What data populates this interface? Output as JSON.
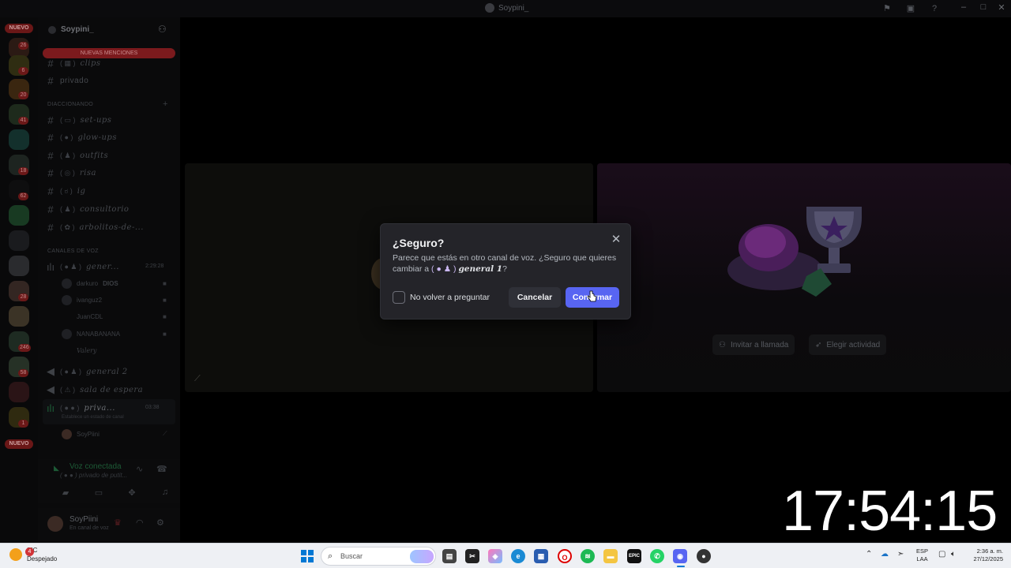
{
  "window": {
    "title": "Soypini_"
  },
  "rail": {
    "nuevo_top": "NUEVO",
    "nuevo_bottom": "NUEVO",
    "badges": [
      "26",
      "6",
      "20",
      "41",
      "18",
      "62",
      "28",
      "246",
      "58",
      "1"
    ]
  },
  "server": {
    "name": "Soypini_",
    "new_mentions": "NUEVAS MENCIONES"
  },
  "channels_top": [
    {
      "label": "clips",
      "emoji": "( ▦ )"
    },
    {
      "label": "privado",
      "emoji": ""
    }
  ],
  "category_1": "DIACCIONANDO",
  "text_channels": [
    {
      "emoji": "( ▭ )",
      "label": "set-ups"
    },
    {
      "emoji": "( ● )",
      "label": "glow-ups"
    },
    {
      "emoji": "( ♟ )",
      "label": "outfits"
    },
    {
      "emoji": "( ◎ )",
      "label": "risa"
    },
    {
      "emoji": "( ಠ )",
      "label": "ig"
    },
    {
      "emoji": "( ♟ )",
      "label": "consultorio"
    },
    {
      "emoji": "( ✿ )",
      "label": "arbolitos-de-..."
    }
  ],
  "category_2": "CANALES DE VOZ",
  "voice_channel_1": {
    "emoji": "( ● ♟ )",
    "label": "gener...",
    "time": "2:29:28"
  },
  "voice_users": [
    {
      "name": "darkuro",
      "tag": "DIOS"
    },
    {
      "name": "ivanguz2",
      "tag": ""
    },
    {
      "name": "JuanCDL",
      "tag": ""
    },
    {
      "name": "NANABANANA",
      "tag": ""
    },
    {
      "name": "Valery",
      "tag": ""
    }
  ],
  "voice_channel_2": {
    "emoji": "( ● ♟ )",
    "label": "general 2"
  },
  "voice_channel_3": {
    "emoji": "( ⚠ )",
    "label": "sala de espera"
  },
  "voice_channel_4": {
    "emoji": "( ● ● )",
    "label": "priva...",
    "time": "03:38",
    "sub": "Establece un estado de canal"
  },
  "voice_user_self": "SoyPiini",
  "voice_panel": {
    "status": "Voz conectada",
    "channel": "( ● ● ) privado de putit..."
  },
  "user": {
    "name": "SoyPiini",
    "status": "En canal de voz"
  },
  "stage": {
    "invite_label": "Invitar a llamada",
    "activity_label": "Elegir actividad"
  },
  "clock": "17:54:15",
  "modal": {
    "title": "¿Seguro?",
    "body_1": "Parece que estás en otro canal de voz. ¿Seguro que quieres cambiar a",
    "channel_emoji": "( ● ♟ )",
    "channel_name": "general 1",
    "body_end": "?",
    "checkbox_label": "No volver a preguntar",
    "cancel": "Cancelar",
    "confirm": "Confirmar"
  },
  "taskbar": {
    "weather_temp": "8°C",
    "weather_desc": "Despejado",
    "weather_badge": "4",
    "search_placeholder": "Buscar",
    "lang_1": "ESP",
    "lang_2": "LAA",
    "time": "2:36 a. m.",
    "date": "27/12/2025"
  },
  "colors": {
    "accent": "#5865f2",
    "modal_bg": "#242429",
    "connected_green": "#1d5a36",
    "mention_red": "#7b1a1d"
  }
}
